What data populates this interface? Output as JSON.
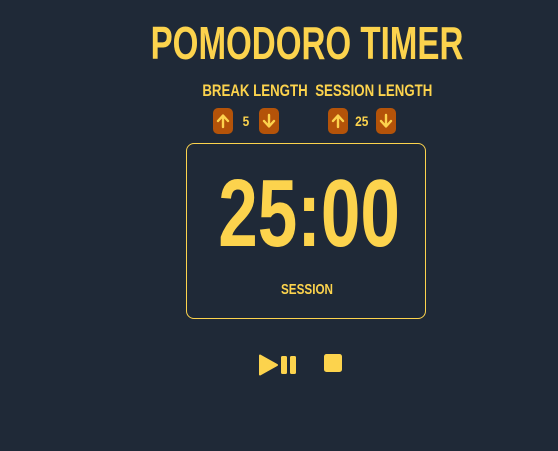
{
  "app": {
    "title": "POMODORO TIMER"
  },
  "break_control": {
    "label": "BREAK LENGTH",
    "value": "5",
    "increment_icon": "arrow-up-icon",
    "decrement_icon": "arrow-down-icon"
  },
  "session_control": {
    "label": "SESSION LENGTH",
    "value": "25",
    "increment_icon": "arrow-up-icon",
    "decrement_icon": "arrow-down-icon"
  },
  "timer": {
    "time": "25:00",
    "label": "SESSION"
  },
  "playback": {
    "play_pause_icon": "play-pause-icon",
    "stop_icon": "stop-icon"
  },
  "colors": {
    "background": "#1f2937",
    "accent": "#fcd34d",
    "button": "#b45309"
  }
}
